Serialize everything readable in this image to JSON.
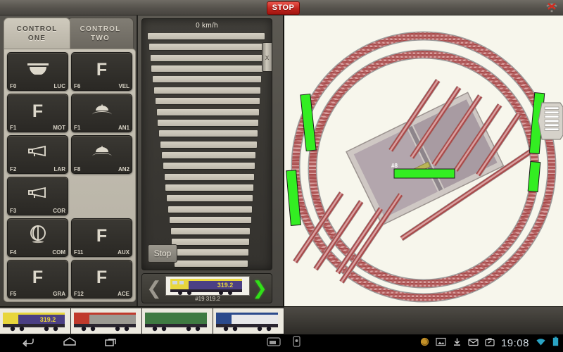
{
  "topbar": {
    "stop_label": "STOP",
    "wifi_icon": "wifi-disconnected-icon"
  },
  "tabs": [
    {
      "line1": "CONTROL",
      "line2": "ONE",
      "active": true,
      "name": "tab-control-one"
    },
    {
      "line1": "CONTROL",
      "line2": "TWO",
      "active": false,
      "name": "tab-control-two"
    }
  ],
  "functions": [
    {
      "key": "F0",
      "abbr": "LUC",
      "icon": "headlight-icon",
      "glyph": ""
    },
    {
      "key": "F6",
      "abbr": "VEL",
      "icon": "f-letter-icon",
      "glyph": "F"
    },
    {
      "key": "F1",
      "abbr": "MOT",
      "icon": "f-letter-icon",
      "glyph": "F"
    },
    {
      "key": "F1",
      "abbr": "AN1",
      "icon": "cap-icon",
      "glyph": ""
    },
    {
      "key": "F2",
      "abbr": "LAR",
      "icon": "horn-icon",
      "glyph": ""
    },
    {
      "key": "F8",
      "abbr": "AN2",
      "icon": "cap-icon",
      "glyph": ""
    },
    {
      "key": "F3",
      "abbr": "COR",
      "icon": "horn-icon",
      "glyph": ""
    },
    {
      "key": "",
      "abbr": "",
      "icon": "empty-slot",
      "glyph": ""
    },
    {
      "key": "F4",
      "abbr": "COM",
      "icon": "bell-icon",
      "glyph": ""
    },
    {
      "key": "F11",
      "abbr": "AUX",
      "icon": "f-letter-icon",
      "glyph": "F"
    },
    {
      "key": "F5",
      "abbr": "GRA",
      "icon": "f-letter-icon",
      "glyph": "F"
    },
    {
      "key": "F12",
      "abbr": "ACE",
      "icon": "f-letter-icon",
      "glyph": "F"
    }
  ],
  "speed": {
    "value_label": "0 km/h",
    "stop_label": "Stop",
    "handle_icon": "slider-handle-icon",
    "rung_count": 22
  },
  "loco": {
    "caption": "#19 319.2",
    "number": "319.2",
    "prev_icon": "chevron-left-icon",
    "next_icon": "chevron-right-icon"
  },
  "layout": {
    "block_label": "#8",
    "occupied_color": "#33ee22",
    "rail_color": "#c26a6a",
    "background": "#f7f6ec",
    "platform_color": "#b3a6ad"
  },
  "gallery": [
    {
      "name": "loco-thumb-319-2",
      "number": "319.2",
      "body": "#4b3f84",
      "cab": "#e8d63c"
    },
    {
      "name": "loco-thumb-red",
      "number": "",
      "body": "#9c9a93",
      "cab": "#c03a2c"
    },
    {
      "name": "loco-thumb-green",
      "number": "",
      "body": "#3f7a42",
      "cab": "#3f7a42"
    },
    {
      "name": "loco-thumb-white",
      "number": "",
      "body": "#e8e8ea",
      "cab": "#2b4a8c"
    }
  ],
  "navbar": {
    "back_icon": "back-arrow-icon",
    "home_icon": "home-icon",
    "recents_icon": "recent-apps-icon",
    "screenshot_icon": "screenshot-icon",
    "lock_icon": "rotation-lock-icon",
    "tray_icons": [
      "sync-icon",
      "image-icon",
      "download-icon",
      "mail-icon",
      "briefcase-icon"
    ],
    "clock": "19:08",
    "wifi_icon": "wifi-icon",
    "battery_icon": "battery-icon"
  }
}
